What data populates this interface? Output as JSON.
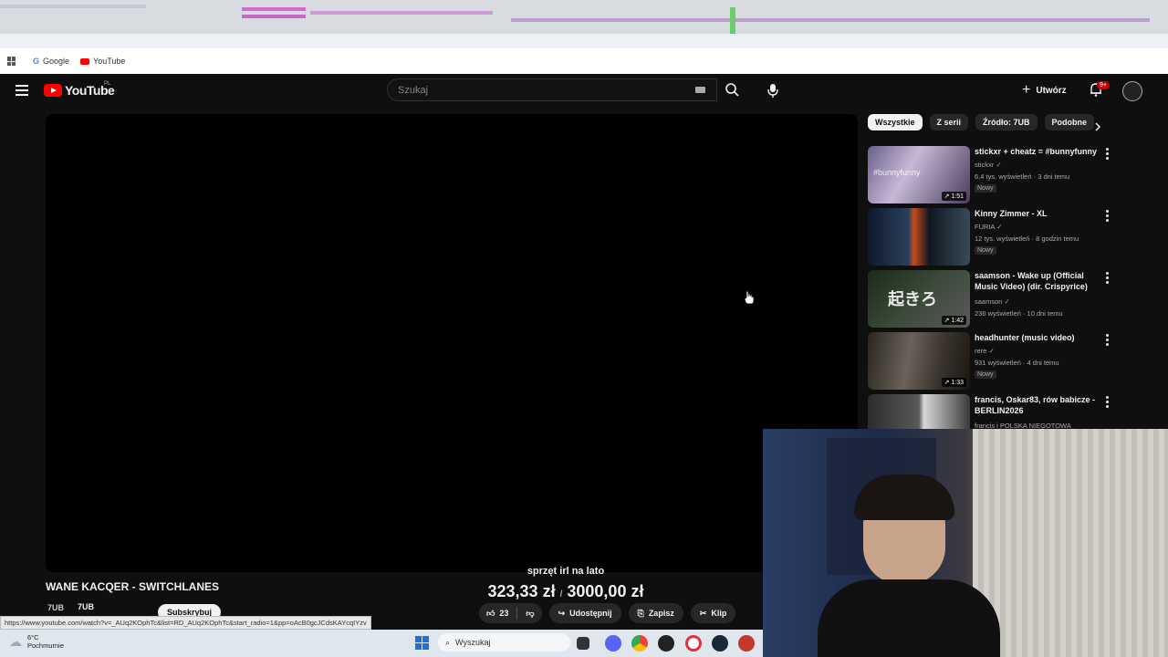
{
  "browser": {
    "bookmarks": [
      {
        "label": "Google",
        "icon": "google-icon"
      },
      {
        "label": "YouTube",
        "icon": "youtube-icon"
      }
    ],
    "status_url": "https://www.youtube.com/watch?v=_AUq2KOphTc&list=RD_AUq2KOphTc&start_radio=1&pp=oAcB0gcJCdsKAYcqIYzv"
  },
  "youtube": {
    "logo_text": "YouTube",
    "logo_region": "PL",
    "search_placeholder": "Szukaj",
    "create_label": "Utwórz",
    "notif_badge": "9+"
  },
  "chips": [
    "Wszystkie",
    "Z serii",
    "Źródło: 7UB",
    "Podobne"
  ],
  "recommendations": [
    {
      "title": "stickxr + cheatz = #bunnyfunny",
      "channel": "stickxr",
      "meta": "6,4 tys. wyświetleń · 3 dni temu",
      "badge": "Nowy",
      "duration": "1:51",
      "thumb_text": "#bunnyfunny"
    },
    {
      "title": "Kinny Zimmer - XL",
      "channel": "FURIA",
      "meta": "12 tys. wyświetleń · 8 godzin temu",
      "badge": "Nowy",
      "duration": "",
      "thumb_text": ""
    },
    {
      "title": "saamson - Wake up (Official Music Video) (dir. Crispyrice)",
      "channel": "saamson",
      "meta": "236 wyświetleń · 10 dni temu",
      "badge": "",
      "duration": "1:42",
      "thumb_text": "起きろ"
    },
    {
      "title": "headhunter (music video)",
      "channel": "rere",
      "meta": "931 wyświetleń · 4 dni temu",
      "badge": "Nowy",
      "duration": "1:33",
      "thumb_text": ""
    },
    {
      "title": "francis, Oskar83, rów babicze - BERLIN2026",
      "channel": "francis i POLSKA NIEGOTOWA",
      "meta": "",
      "badge": "",
      "duration": "",
      "thumb_text": ""
    }
  ],
  "video": {
    "title": "WANE KACQER - SWITCHLANES",
    "channel": "7UB",
    "channel_logo": "7UB",
    "subscribe_label": "Subskrybuj",
    "likes": "23",
    "share_label": "Udostępnij",
    "save_label": "Zapisz",
    "clip_label": "Klip"
  },
  "stream_overlay": {
    "goal_title": "sprzęt irl na lato",
    "goal_current": "323,33 zł",
    "goal_sep": "/",
    "goal_target": "3000,00 zł"
  },
  "taskbar": {
    "temp": "6°C",
    "weather": "Pochmurnie",
    "search_placeholder": "Wyszukaj"
  }
}
